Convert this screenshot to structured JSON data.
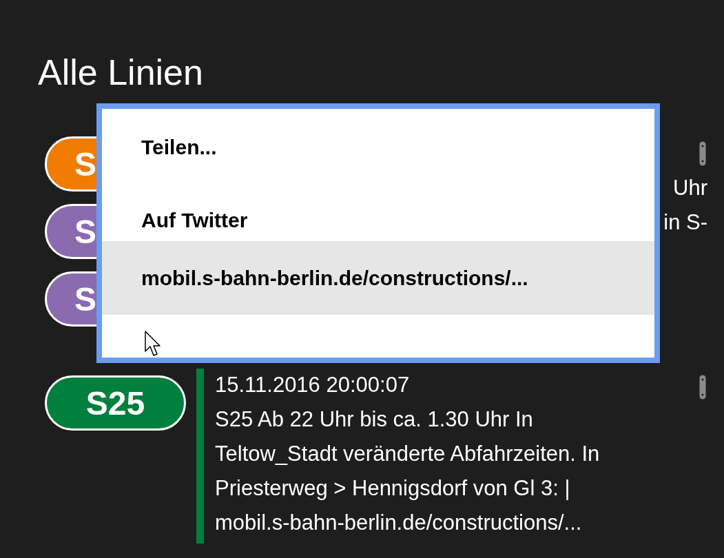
{
  "title": "Alle Linien",
  "covered_lines": [
    {
      "badge": "S",
      "color": "#ef7c00"
    },
    {
      "badge": "S",
      "color": "#8a6bb0"
    },
    {
      "badge": "S",
      "color": "#8a6bb0"
    }
  ],
  "covered_message": {
    "pinned": true,
    "fragments": [
      "Uhr",
      "in S-"
    ]
  },
  "messages": [
    {
      "badge": "S25",
      "color": "#007f3d",
      "pinned": true,
      "time": "15.11.2016 20:00:07",
      "lines": [
        "S25 Ab 22 Uhr bis ca. 1.30 Uhr In",
        "Teltow_Stadt veränderte Abfahrzeiten. In",
        "Priesterweg > Hennigsdorf von Gl 3: |",
        "mobil.s-bahn-berlin.de/constructions/..."
      ]
    }
  ],
  "context_menu": {
    "items": [
      {
        "label": "Teilen...",
        "selected": false
      },
      {
        "label": "Auf Twitter",
        "selected": false
      },
      {
        "label": "mobil.s-bahn-berlin.de/constructions/...",
        "selected": true
      }
    ]
  }
}
